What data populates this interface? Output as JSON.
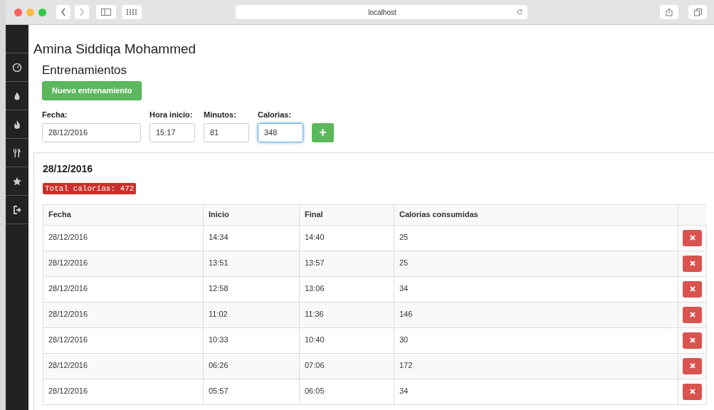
{
  "browser": {
    "address": "localhost"
  },
  "user_name": "Amina Siddiqa Mohammed",
  "section_title": "Entrenamientos",
  "new_button": "Nuevo entrenamiento",
  "form": {
    "fields": [
      {
        "label": "Fecha:",
        "value": "28/12/2016",
        "focused": false
      },
      {
        "label": "Hora inicio:",
        "value": "15:17",
        "focused": false
      },
      {
        "label": "Minutos:",
        "value": "81",
        "focused": false
      },
      {
        "label": "Calorias:",
        "value": "348",
        "focused": true
      }
    ],
    "add_button": "+"
  },
  "day": {
    "date": "28/12/2016",
    "total_badge": "Total calorías: 472"
  },
  "table": {
    "columns": [
      "Fecha",
      "Inicio",
      "Final",
      "Calorías consumidas"
    ],
    "rows": [
      [
        "28/12/2016",
        "14:34",
        "14:40",
        "25"
      ],
      [
        "28/12/2016",
        "13:51",
        "13:57",
        "25"
      ],
      [
        "28/12/2016",
        "12:58",
        "13:06",
        "34"
      ],
      [
        "28/12/2016",
        "11:02",
        "11:36",
        "146"
      ],
      [
        "28/12/2016",
        "10:33",
        "10:40",
        "30"
      ],
      [
        "28/12/2016",
        "06:26",
        "07:06",
        "172"
      ],
      [
        "28/12/2016",
        "05:57",
        "06:05",
        "34"
      ]
    ]
  }
}
